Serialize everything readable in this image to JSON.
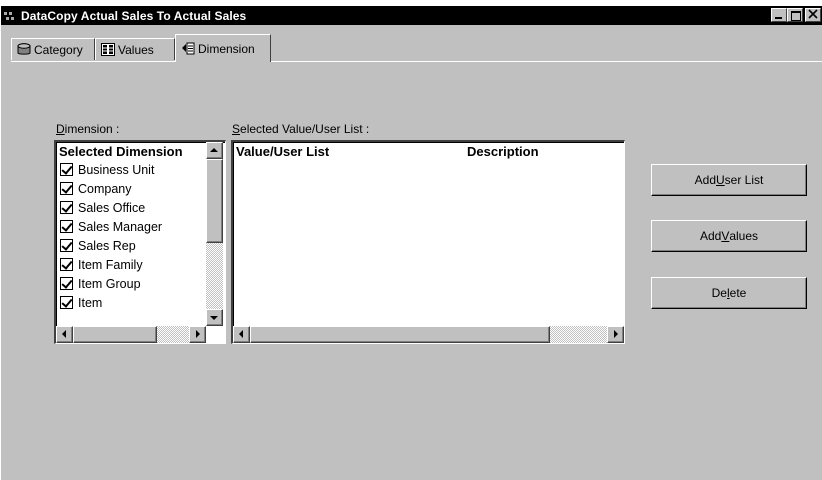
{
  "window": {
    "title": "DataCopy Actual Sales To Actual Sales"
  },
  "tabs": [
    {
      "label": "Category",
      "icon": "database-icon"
    },
    {
      "label": "Values",
      "icon": "columns-icon"
    },
    {
      "label": "Dimension",
      "icon": "dimension-icon",
      "active": true
    }
  ],
  "dimension_panel": {
    "label_prefix": "D",
    "label_rest": "imension :",
    "header": "Selected Dimension",
    "items": [
      {
        "label": "Business Unit",
        "checked": true
      },
      {
        "label": "Company",
        "checked": true
      },
      {
        "label": "Sales Office",
        "checked": true
      },
      {
        "label": "Sales Manager",
        "checked": true
      },
      {
        "label": "Sales Rep",
        "checked": true
      },
      {
        "label": "Item Family",
        "checked": true
      },
      {
        "label": "Item Group",
        "checked": true
      },
      {
        "label": "Item",
        "checked": true
      }
    ]
  },
  "value_panel": {
    "label_prefix": "S",
    "label_rest": "elected Value/User List :",
    "columns": [
      "Value/User List",
      "Description"
    ]
  },
  "buttons": {
    "add_user_list": {
      "pre": "Add ",
      "key": "U",
      "post": "ser List"
    },
    "add_values": {
      "pre": "Add ",
      "key": "V",
      "post": "alues"
    },
    "delete": {
      "pre": "De",
      "key": "l",
      "post": "ete"
    }
  }
}
